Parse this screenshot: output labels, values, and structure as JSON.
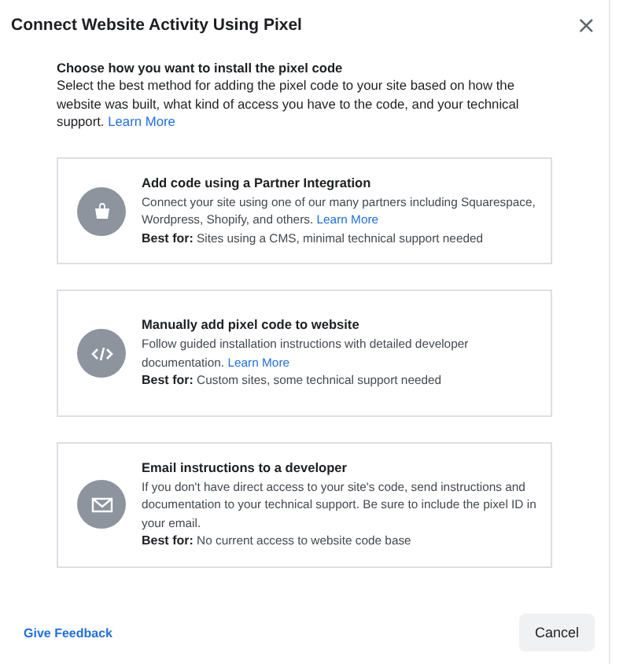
{
  "dialog": {
    "title": "Connect Website Activity Using Pixel",
    "close": "×"
  },
  "intro": {
    "heading": "Choose how you want to install the pixel code",
    "text": "Select the best method for adding the pixel code to your site based on how the website was built, what kind of access you have to the code, and your technical support.",
    "link": "Learn More"
  },
  "options": [
    {
      "kind": "partner",
      "title": "Add code using a Partner Integration",
      "description": "Connect your site using one of our many partners including Squarespace, Wordpress, Shopify, and others.",
      "link": "Learn More",
      "best_for": "**Best for:** Sites using a CMS, minimal technical support needed"
    },
    {
      "kind": "manual",
      "title": "Manually add pixel code to website",
      "description": "Follow guided installation instructions with detailed developer documentation.",
      "link": "Learn More",
      "best_for": "**Best for:** Custom sites, some technical support needed"
    },
    {
      "kind": "email",
      "title": "Email instructions to a developer",
      "description": "If you don't have direct access to your site's code, send instructions and documentation to your technical support. Be sure to include the pixel ID in your email.",
      "best_for": "**Best for:** No current access to website code base"
    }
  ],
  "footer": {
    "feedback": "Give Feedback",
    "cancel": "Cancel"
  }
}
